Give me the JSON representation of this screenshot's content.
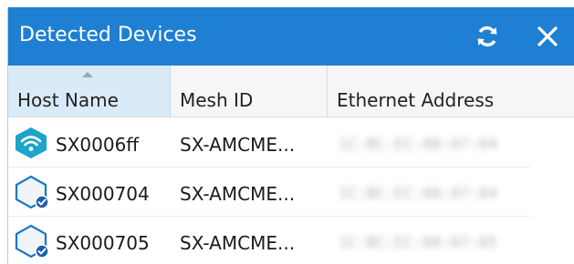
{
  "window": {
    "title": "Detected Devices",
    "refresh_icon": "refresh-icon",
    "close_icon": "close-icon",
    "accent_color": "#1f7fd3"
  },
  "table": {
    "columns": [
      {
        "label": "Host Name",
        "sorted": "ascending"
      },
      {
        "label": "Mesh ID"
      },
      {
        "label": "Ethernet Address"
      }
    ],
    "rows": [
      {
        "icon": "wifi-hex-icon",
        "host": "SX0006ff",
        "mesh": "SX-AMCME...",
        "ethernet": "1C:BC:EC:00:07:04"
      },
      {
        "icon": "hex-check-icon",
        "host": "SX000704",
        "mesh": "SX-AMCME...",
        "ethernet": "1C:BC:EC:00:07:04"
      },
      {
        "icon": "hex-check-icon",
        "host": "SX000705",
        "mesh": "SX-AMCME...",
        "ethernet": "1C:BC:EC:00:07:05"
      }
    ]
  }
}
